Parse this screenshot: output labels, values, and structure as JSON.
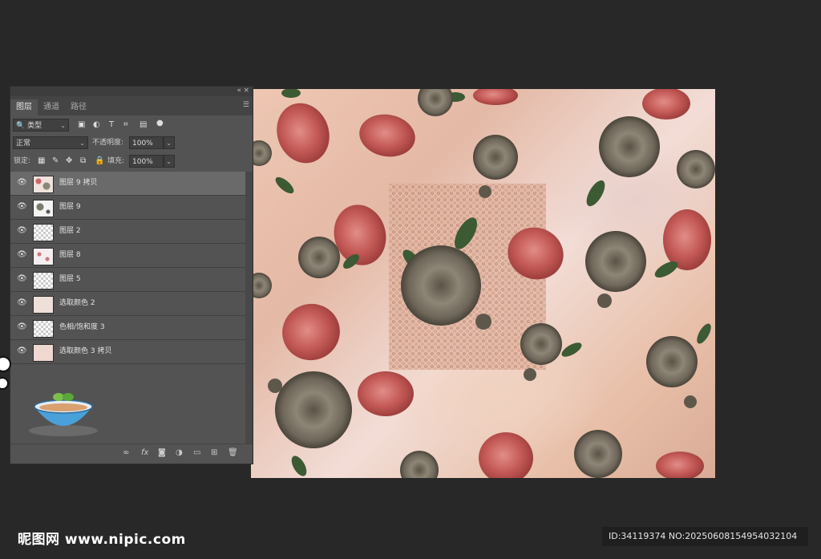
{
  "panel": {
    "collapse_icons": [
      "«",
      "×"
    ],
    "tabs": [
      {
        "label": "图层",
        "active": true
      },
      {
        "label": "通道",
        "active": false
      },
      {
        "label": "路径",
        "active": false
      }
    ],
    "filter": {
      "label": "类型",
      "icons": [
        "image-filter-icon",
        "adjustment-filter-icon",
        "type-filter-icon",
        "shape-filter-icon",
        "smart-object-filter-icon",
        "filter-toggle-icon"
      ]
    },
    "blend_mode": "正常",
    "opacity_label": "不透明度:",
    "opacity_value": "100%",
    "lock_label": "锁定:",
    "fill_label": "填充:",
    "fill_value": "100%",
    "layers": [
      {
        "name": "图层 9 拷贝",
        "selected": true,
        "thumb": "pat"
      },
      {
        "name": "图层 9",
        "selected": false,
        "thumb": "pat2"
      },
      {
        "name": "图层 2",
        "selected": false,
        "thumb": "trans"
      },
      {
        "name": "图层 8",
        "selected": false,
        "thumb": "pat3"
      },
      {
        "name": "图层 5",
        "selected": false,
        "thumb": "trans"
      },
      {
        "name": "选取颜色 2",
        "selected": false,
        "thumb": "adj2"
      },
      {
        "name": "色相/饱和度 3",
        "selected": false,
        "thumb": "trans"
      },
      {
        "name": "选取颜色 3 拷贝",
        "selected": false,
        "thumb": "adj"
      }
    ],
    "bottom_icons": [
      "link-layers-icon",
      "fx-icon",
      "add-mask-icon",
      "new-adjustment-icon",
      "new-group-icon",
      "new-layer-icon",
      "delete-layer-icon"
    ],
    "fx_label": "fx"
  },
  "watermark": {
    "logo_text": "昵图网 www.nipic.com",
    "id_text": "ID:34119374 NO:20250608154954032104"
  },
  "colors": {
    "app_bg": "#282828",
    "panel_bg": "#535353",
    "selected_layer": "#6a6a6a"
  }
}
